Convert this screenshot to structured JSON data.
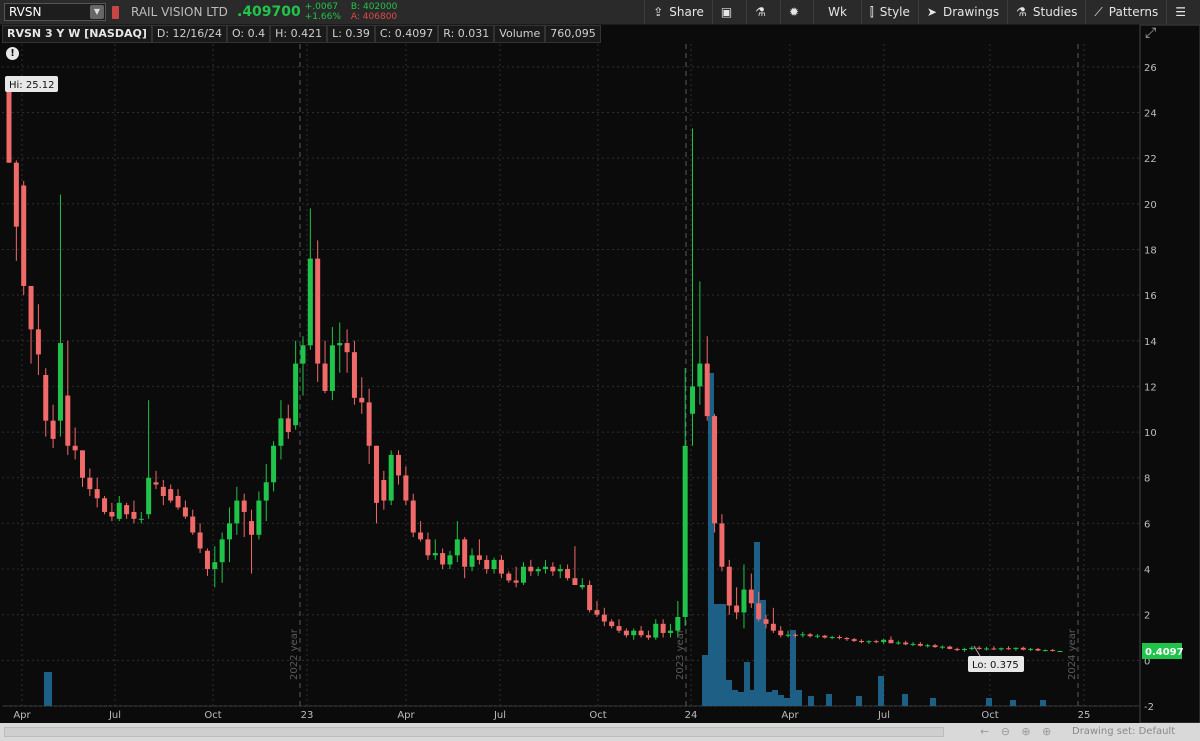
{
  "toolbar": {
    "symbol": "RVSN",
    "company": "RAIL VISION LTD",
    "last": ".409700",
    "change": "+.0067",
    "change_pct": "+1.66%",
    "bid": "B: 402000",
    "ask": "A: 406800",
    "buttons": {
      "share": "Share",
      "interval": "Wk",
      "style": "Style",
      "drawings": "Drawings",
      "studies": "Studies",
      "patterns": "Patterns"
    }
  },
  "header": {
    "title": "RVSN 3 Y W [NASDAQ]",
    "date": "D: 12/16/24",
    "open": "O: 0.4",
    "high": "H: 0.421",
    "low": "L: 0.39",
    "close": "C: 0.4097",
    "range": "R: 0.031",
    "volume_label": "Volume",
    "volume_value": "760,095"
  },
  "chart_data": {
    "type": "candlestick",
    "period": "weekly",
    "y_ticks": [
      "26",
      "24",
      "22",
      "20",
      "18",
      "16",
      "14",
      "12",
      "10",
      "8",
      "6",
      "4",
      "2",
      "0",
      "-2"
    ],
    "x_ticks": [
      "Apr",
      "Jul",
      "Oct",
      "23",
      "Apr",
      "Jul",
      "Oct",
      "24",
      "Apr",
      "Jul",
      "Oct",
      "25"
    ],
    "year_separators": [
      "2022 year",
      "2023 year",
      "2024 year"
    ],
    "hi_label": "Hi: 25.12",
    "lo_label": "Lo: 0.375",
    "last_price_label": "0.4097",
    "colors": {
      "up": "#21c44a",
      "down": "#f06a6a",
      "volume": "#1d5f85",
      "grid": "#2e2e2e"
    },
    "ylim": [
      -2,
      27
    ],
    "candles": [
      [
        25.1,
        25.12,
        21.8,
        21.8
      ],
      [
        21.8,
        21.9,
        17.5,
        19.0
      ],
      [
        20.8,
        21.0,
        16.0,
        16.4
      ],
      [
        16.4,
        16.4,
        13.0,
        14.5
      ],
      [
        14.5,
        15.6,
        12.5,
        13.4
      ],
      [
        12.5,
        12.8,
        9.8,
        10.5
      ],
      [
        10.5,
        11.2,
        9.3,
        9.7
      ],
      [
        10.5,
        20.4,
        9.8,
        13.9
      ],
      [
        11.6,
        14.0,
        9.0,
        9.4
      ],
      [
        9.4,
        10.2,
        8.8,
        9.2
      ],
      [
        9.2,
        9.2,
        7.6,
        8.0
      ],
      [
        8.0,
        8.4,
        7.2,
        7.5
      ],
      [
        7.5,
        8.0,
        6.7,
        7.1
      ],
      [
        7.1,
        7.2,
        6.4,
        6.5
      ],
      [
        6.5,
        6.9,
        6.1,
        6.3
      ],
      [
        6.2,
        7.2,
        6.1,
        6.9
      ],
      [
        6.8,
        6.9,
        6.2,
        6.4
      ],
      [
        6.5,
        7.0,
        6.0,
        6.2
      ],
      [
        6.2,
        6.5,
        6.0,
        6.2
      ],
      [
        6.4,
        11.4,
        6.2,
        8.0
      ],
      [
        7.8,
        8.3,
        7.5,
        7.7
      ],
      [
        7.6,
        7.9,
        6.8,
        7.2
      ],
      [
        7.5,
        7.7,
        6.9,
        7.0
      ],
      [
        7.2,
        7.5,
        6.6,
        6.7
      ],
      [
        6.7,
        7.0,
        6.2,
        6.3
      ],
      [
        6.3,
        6.6,
        5.5,
        5.6
      ],
      [
        5.6,
        6.0,
        4.7,
        4.9
      ],
      [
        4.8,
        4.9,
        3.7,
        4.0
      ],
      [
        4.0,
        5.0,
        3.2,
        4.3
      ],
      [
        4.3,
        5.6,
        3.4,
        5.3
      ],
      [
        5.3,
        6.7,
        4.3,
        6.0
      ],
      [
        6.0,
        7.6,
        5.5,
        7.0
      ],
      [
        7.0,
        7.3,
        5.4,
        6.5
      ],
      [
        6.1,
        6.6,
        3.8,
        5.5
      ],
      [
        5.5,
        7.4,
        5.3,
        7.0
      ],
      [
        7.0,
        8.6,
        6.1,
        7.8
      ],
      [
        7.8,
        9.6,
        7.4,
        9.4
      ],
      [
        9.4,
        11.4,
        8.8,
        10.6
      ],
      [
        10.6,
        11.2,
        9.7,
        10.0
      ],
      [
        10.3,
        14.0,
        10.1,
        13.0
      ],
      [
        13.0,
        14.2,
        11.6,
        13.8
      ],
      [
        13.8,
        19.8,
        13.6,
        17.6
      ],
      [
        17.6,
        18.4,
        12.2,
        13.0
      ],
      [
        13.0,
        14.0,
        11.7,
        11.8
      ],
      [
        11.8,
        14.6,
        11.4,
        13.8
      ],
      [
        13.8,
        14.8,
        12.6,
        13.9
      ],
      [
        13.9,
        14.5,
        12.6,
        13.5
      ],
      [
        13.5,
        14.0,
        11.2,
        11.5
      ],
      [
        11.5,
        12.4,
        10.8,
        11.3
      ],
      [
        11.3,
        11.9,
        8.6,
        9.4
      ],
      [
        9.4,
        9.4,
        6.0,
        6.9
      ],
      [
        7.9,
        8.3,
        6.6,
        7.0
      ],
      [
        7.0,
        9.2,
        6.8,
        9.0
      ],
      [
        9.0,
        9.2,
        7.7,
        8.1
      ],
      [
        8.1,
        8.5,
        6.8,
        7.0
      ],
      [
        7.0,
        7.3,
        5.4,
        5.6
      ],
      [
        5.6,
        6.1,
        5.2,
        5.3
      ],
      [
        5.3,
        5.6,
        4.4,
        4.6
      ],
      [
        4.6,
        5.3,
        4.4,
        4.7
      ],
      [
        4.7,
        4.9,
        4.0,
        4.2
      ],
      [
        4.2,
        4.8,
        4.0,
        4.6
      ],
      [
        4.6,
        6.1,
        4.3,
        5.3
      ],
      [
        5.3,
        5.4,
        3.6,
        4.1
      ],
      [
        4.1,
        4.9,
        3.9,
        4.6
      ],
      [
        4.6,
        5.3,
        4.2,
        4.4
      ],
      [
        4.4,
        4.6,
        3.8,
        4.0
      ],
      [
        4.0,
        4.5,
        3.8,
        4.4
      ],
      [
        4.4,
        4.6,
        3.6,
        3.8
      ],
      [
        3.8,
        3.9,
        3.4,
        3.5
      ],
      [
        3.5,
        4.1,
        3.2,
        3.4
      ],
      [
        3.4,
        4.3,
        3.3,
        4.1
      ],
      [
        4.1,
        4.4,
        3.7,
        3.9
      ],
      [
        3.9,
        4.1,
        3.7,
        4.0
      ],
      [
        4.0,
        4.4,
        3.8,
        4.1
      ],
      [
        4.1,
        4.3,
        3.7,
        3.9
      ],
      [
        3.9,
        4.2,
        3.6,
        4.0
      ],
      [
        4.0,
        4.2,
        3.5,
        3.6
      ],
      [
        3.6,
        5.0,
        3.3,
        3.3
      ],
      [
        3.2,
        3.6,
        3.1,
        3.3
      ],
      [
        3.3,
        3.5,
        2.1,
        2.2
      ],
      [
        2.2,
        2.6,
        1.9,
        2.0
      ],
      [
        2.0,
        2.3,
        1.5,
        1.7
      ],
      [
        1.7,
        1.8,
        1.4,
        1.5
      ],
      [
        1.5,
        1.8,
        1.2,
        1.3
      ],
      [
        1.3,
        1.4,
        1.0,
        1.1
      ],
      [
        1.1,
        1.4,
        0.9,
        1.3
      ],
      [
        1.3,
        1.5,
        1.0,
        1.1
      ],
      [
        1.1,
        1.3,
        0.9,
        1.0
      ],
      [
        1.0,
        1.8,
        0.9,
        1.6
      ],
      [
        1.6,
        1.8,
        1.0,
        1.2
      ],
      [
        1.2,
        1.6,
        1.0,
        1.3
      ],
      [
        1.3,
        2.6,
        1.0,
        1.9
      ],
      [
        1.9,
        12.8,
        1.5,
        9.4
      ],
      [
        10.8,
        23.3,
        9.4,
        12.0
      ],
      [
        12.0,
        16.6,
        11.2,
        13.0
      ],
      [
        13.0,
        14.2,
        10.5,
        10.7
      ],
      [
        10.7,
        10.8,
        5.6,
        6.0
      ],
      [
        6.0,
        6.4,
        3.9,
        4.1
      ],
      [
        4.1,
        4.4,
        2.0,
        2.4
      ],
      [
        2.4,
        3.2,
        1.8,
        2.1
      ],
      [
        2.1,
        4.2,
        1.4,
        3.1
      ],
      [
        3.1,
        3.8,
        2.3,
        2.5
      ],
      [
        2.5,
        3.0,
        1.7,
        1.8
      ],
      [
        1.8,
        2.0,
        1.4,
        1.6
      ],
      [
        1.6,
        2.3,
        1.2,
        1.3
      ],
      [
        1.3,
        1.5,
        1.0,
        1.1
      ],
      [
        1.1,
        1.3,
        1.0,
        1.12
      ],
      [
        1.12,
        1.2,
        1.0,
        1.1
      ],
      [
        1.1,
        1.25,
        1.0,
        1.14
      ],
      [
        1.14,
        1.2,
        1.0,
        1.06
      ],
      [
        1.06,
        1.15,
        0.97,
        1.08
      ],
      [
        1.08,
        1.12,
        0.95,
        1.0
      ],
      [
        1.0,
        1.08,
        0.93,
        1.02
      ],
      [
        1.02,
        1.1,
        0.92,
        0.98
      ],
      [
        0.98,
        1.02,
        0.85,
        0.93
      ],
      [
        0.93,
        0.98,
        0.8,
        0.85
      ],
      [
        0.85,
        0.92,
        0.75,
        0.8
      ],
      [
        0.8,
        0.88,
        0.72,
        0.84
      ],
      [
        0.84,
        0.9,
        0.75,
        0.8
      ],
      [
        0.8,
        0.95,
        0.72,
        0.9
      ],
      [
        0.9,
        1.05,
        0.8,
        0.75
      ],
      [
        0.75,
        0.86,
        0.68,
        0.78
      ],
      [
        0.78,
        0.86,
        0.66,
        0.7
      ],
      [
        0.7,
        0.8,
        0.62,
        0.72
      ],
      [
        0.72,
        0.8,
        0.6,
        0.64
      ],
      [
        0.64,
        0.72,
        0.56,
        0.66
      ],
      [
        0.66,
        0.72,
        0.55,
        0.58
      ],
      [
        0.58,
        0.65,
        0.5,
        0.6
      ],
      [
        0.6,
        0.64,
        0.48,
        0.5
      ],
      [
        0.5,
        0.55,
        0.4,
        0.45
      ],
      [
        0.45,
        0.55,
        0.375,
        0.5
      ],
      [
        0.5,
        0.62,
        0.44,
        0.55
      ],
      [
        0.55,
        0.62,
        0.46,
        0.5
      ],
      [
        0.5,
        0.58,
        0.43,
        0.52
      ],
      [
        0.52,
        0.62,
        0.45,
        0.48
      ],
      [
        0.48,
        0.56,
        0.42,
        0.53
      ],
      [
        0.53,
        0.62,
        0.46,
        0.5
      ],
      [
        0.5,
        0.56,
        0.42,
        0.55
      ],
      [
        0.55,
        0.6,
        0.44,
        0.47
      ],
      [
        0.47,
        0.54,
        0.4,
        0.5
      ],
      [
        0.5,
        0.54,
        0.4,
        0.43
      ],
      [
        0.43,
        0.48,
        0.39,
        0.45
      ],
      [
        0.45,
        0.5,
        0.39,
        0.42
      ],
      [
        0.4,
        0.421,
        0.39,
        0.4097
      ]
    ],
    "volume": [
      0,
      0,
      0,
      0,
      0,
      0,
      0,
      30,
      0,
      0,
      0,
      0,
      0,
      0,
      0,
      0,
      0,
      0,
      0,
      0,
      0,
      0,
      0,
      0,
      0,
      0,
      0,
      0,
      0,
      0,
      0,
      0,
      0,
      0,
      0,
      0,
      0,
      0,
      0,
      0,
      0,
      0,
      0,
      0,
      0,
      0,
      0,
      0,
      0,
      0,
      0,
      0,
      0,
      0,
      0,
      0,
      0,
      0,
      0,
      0,
      0,
      0,
      0,
      0,
      0,
      0,
      0,
      0,
      0,
      0,
      0,
      0,
      0,
      0,
      0,
      0,
      0,
      0,
      0,
      0,
      0,
      0,
      0,
      0,
      0,
      0,
      0,
      0,
      0,
      0,
      0,
      0,
      0,
      0,
      0,
      0,
      0,
      0,
      0,
      0,
      0,
      0,
      0,
      0,
      0,
      0,
      0,
      0,
      0,
      0,
      0,
      0,
      0,
      0,
      0,
      0,
      0,
      0,
      0,
      0,
      0,
      0,
      0,
      0,
      0,
      0,
      0,
      0,
      0,
      0,
      0,
      0,
      0,
      0,
      0,
      0,
      0,
      0,
      0,
      0,
      0,
      0,
      0,
      0,
      0,
      0
    ]
  },
  "bottom": {
    "drawing_set": "Drawing set: Default"
  }
}
